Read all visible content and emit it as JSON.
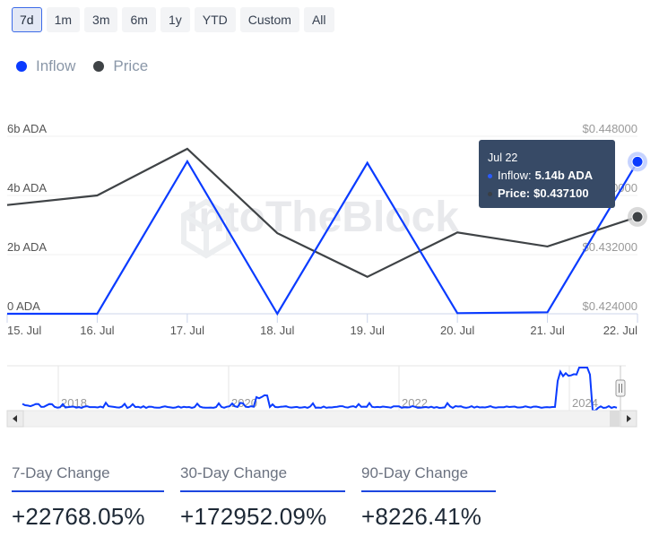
{
  "ranges": [
    {
      "label": "7d",
      "active": true
    },
    {
      "label": "1m",
      "active": false
    },
    {
      "label": "3m",
      "active": false
    },
    {
      "label": "6m",
      "active": false
    },
    {
      "label": "1y",
      "active": false
    },
    {
      "label": "YTD",
      "active": false
    },
    {
      "label": "Custom",
      "active": false
    },
    {
      "label": "All",
      "active": false
    }
  ],
  "legend": [
    {
      "label": "Inflow",
      "color": "#0a3bff"
    },
    {
      "label": "Price",
      "color": "#3f4346"
    }
  ],
  "watermark": "IntoTheBlock",
  "tooltip": {
    "date": "Jul 22",
    "inflow_label": "Inflow: ",
    "inflow_value": "5.14b ADA",
    "price_label": "Price: ",
    "price_value": "$0.437100"
  },
  "chart_data": {
    "type": "line",
    "title": "",
    "x": [
      "15. Jul",
      "16. Jul",
      "17. Jul",
      "18. Jul",
      "19. Jul",
      "20. Jul",
      "21. Jul",
      "22. Jul"
    ],
    "series": [
      {
        "name": "Inflow",
        "axis": "left",
        "unit": "b ADA",
        "color": "#0a3bff",
        "values": [
          0.0,
          0.0,
          5.15,
          0.0,
          5.1,
          0.02,
          0.05,
          5.14
        ]
      },
      {
        "name": "Price",
        "axis": "right",
        "unit": "USD",
        "color": "#3f4346",
        "values": [
          0.4387,
          0.44,
          0.4463,
          0.4349,
          0.429,
          0.435,
          0.4331,
          0.4371
        ]
      }
    ],
    "y_left": {
      "ticks": [
        "0 ADA",
        "2b ADA",
        "4b ADA",
        "6b ADA"
      ],
      "tick_values": [
        0,
        2,
        4,
        6
      ],
      "range": [
        0,
        6
      ]
    },
    "y_right": {
      "ticks": [
        "$0.424000",
        "$0.432000",
        "$0.440000",
        "$0.448000"
      ],
      "tick_values": [
        0.424,
        0.432,
        0.44,
        0.448
      ],
      "range": [
        0.424,
        0.448
      ]
    },
    "grid": true,
    "legend": "top-left",
    "highlighted_index": 7,
    "navigator": {
      "year_labels": [
        "2018",
        "2020",
        "2022",
        "2024"
      ],
      "range_years": [
        2017.4,
        2024.6
      ]
    }
  },
  "changes": [
    {
      "label": "7-Day Change",
      "value": "+22768.05%"
    },
    {
      "label": "30-Day Change",
      "value": "+172952.09%"
    },
    {
      "label": "90-Day Change",
      "value": "+8226.41%"
    }
  ]
}
